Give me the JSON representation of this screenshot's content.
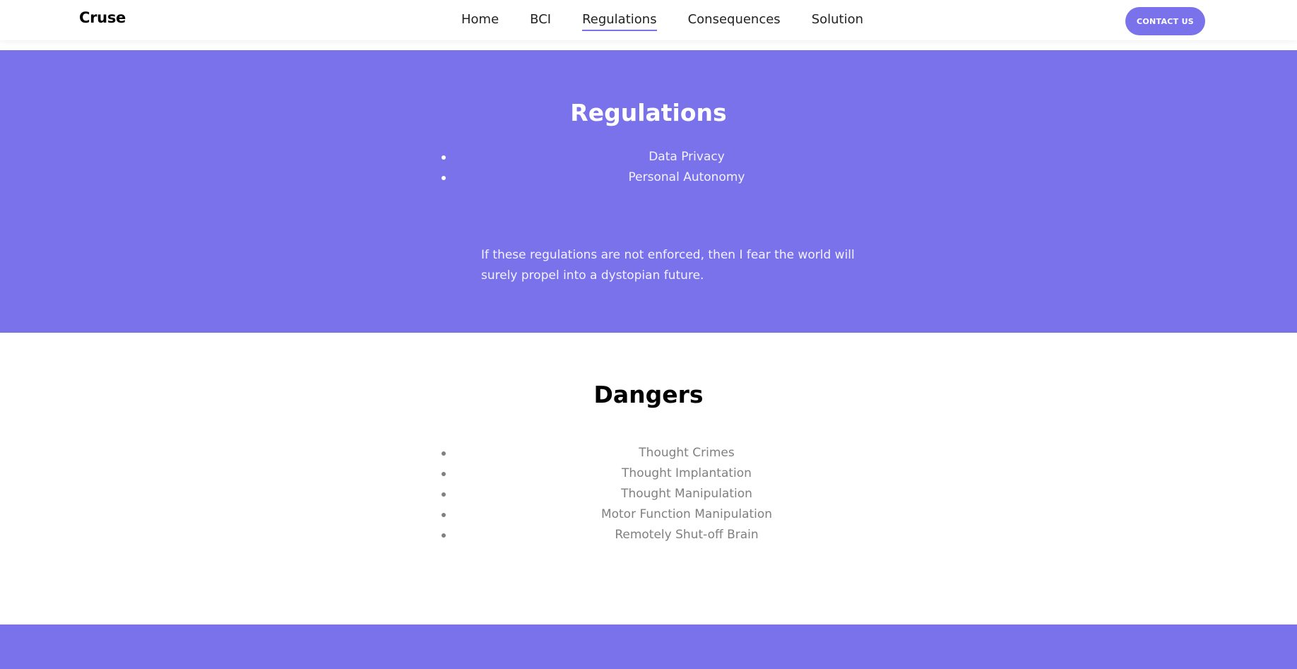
{
  "header": {
    "brand": "Cruse",
    "nav": [
      {
        "label": "Home",
        "active": false
      },
      {
        "label": "BCI",
        "active": false
      },
      {
        "label": "Regulations",
        "active": true
      },
      {
        "label": "Consequences",
        "active": false
      },
      {
        "label": "Solution",
        "active": false
      }
    ],
    "contact_label": "CONTACT US"
  },
  "regulations": {
    "title": "Regulations",
    "items": [
      "Data Privacy",
      "Personal Autonomy"
    ],
    "quote": "If these regulations are not enforced, then I fear the world will surely propel into a dystopian future."
  },
  "dangers": {
    "title": "Dangers",
    "items": [
      "Thought Crimes",
      "Thought Implantation",
      "Thought Manipulation",
      "Motor Function Manipulation",
      "Remotely Shut-off Brain"
    ]
  },
  "colors": {
    "accent": "#7a72ea",
    "muted_text": "#808080"
  }
}
